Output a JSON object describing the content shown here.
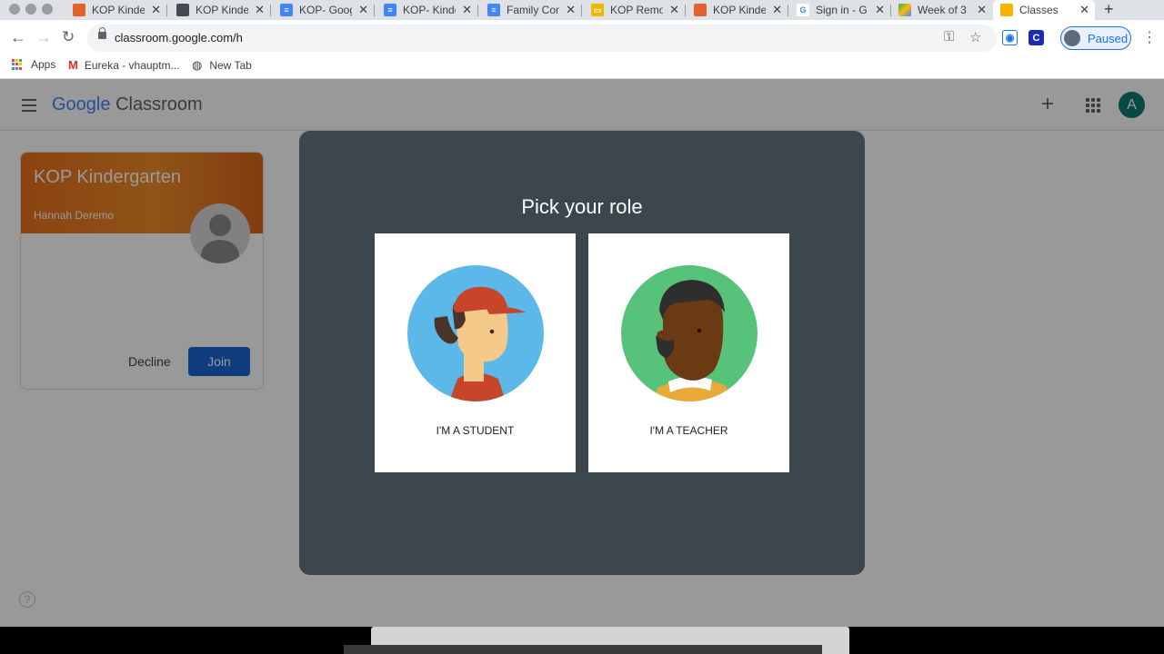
{
  "browser": {
    "tabs": [
      {
        "title": "KOP Kinder",
        "favicon": "orange-person-icon",
        "color": "#e2622b"
      },
      {
        "title": "KOP Kinder",
        "favicon": "dark-person-icon",
        "color": "#444a50"
      },
      {
        "title": "KOP- Goog",
        "favicon": "docs-icon",
        "color": "#4285f4"
      },
      {
        "title": "KOP- Kinde",
        "favicon": "docs-icon",
        "color": "#4285f4"
      },
      {
        "title": "Family Con",
        "favicon": "docs-icon",
        "color": "#4285f4"
      },
      {
        "title": "KOP Remo",
        "favicon": "slides-icon",
        "color": "#f4b400"
      },
      {
        "title": "KOP Kinder",
        "favicon": "orange-person-icon",
        "color": "#e2622b"
      },
      {
        "title": "Sign in - G",
        "favicon": "google-icon",
        "color": "#ffffff"
      },
      {
        "title": "Week of 3",
        "favicon": "drive-icon",
        "color": "#34a853"
      },
      {
        "title": "Classes",
        "favicon": "classroom-icon",
        "color": "#f4b400"
      }
    ],
    "url": "classroom.google.com/h",
    "profile_label": "Paused",
    "bookmarks": [
      "Apps",
      "Eureka - vhauptm...",
      "New Tab"
    ]
  },
  "app": {
    "brand_google": "Google",
    "brand_product": "Classroom",
    "account_initial": "A"
  },
  "class_card": {
    "title": "KOP Kindergarten",
    "owner": "Hannah Deremo",
    "decline_label": "Decline",
    "join_label": "Join"
  },
  "help_glyph": "?",
  "dialog": {
    "title": "Pick your role",
    "student_label": "I'M A STUDENT",
    "teacher_label": "I'M A TEACHER"
  }
}
